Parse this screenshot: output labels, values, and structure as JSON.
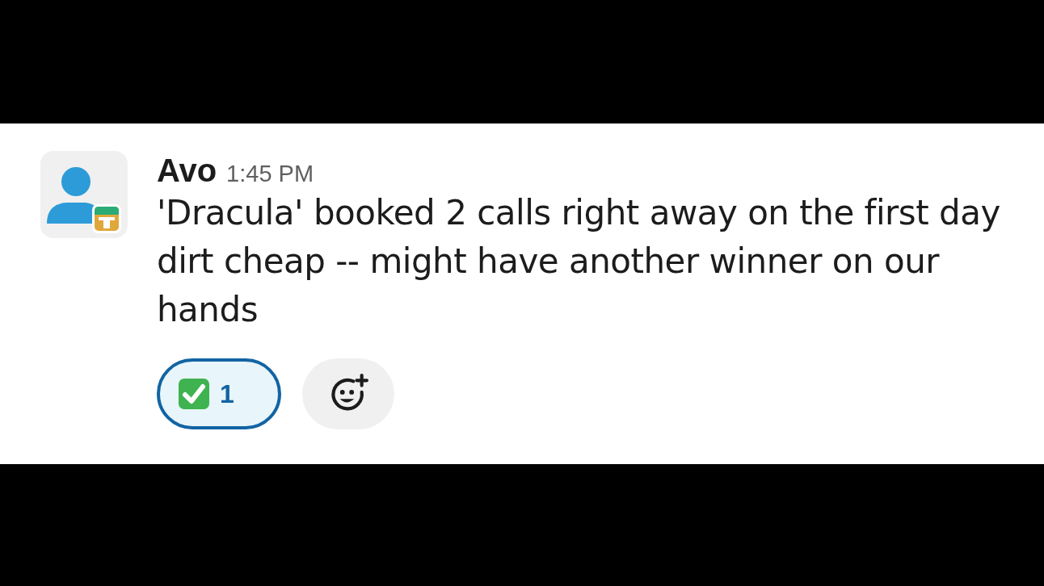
{
  "message": {
    "author": "Avo",
    "time": "1:45 PM",
    "text": "'Dracula' booked 2 calls right away on the first day dirt cheap -- might have another winner on our hands",
    "reactions": [
      {
        "count": "1",
        "selected": true
      }
    ]
  }
}
